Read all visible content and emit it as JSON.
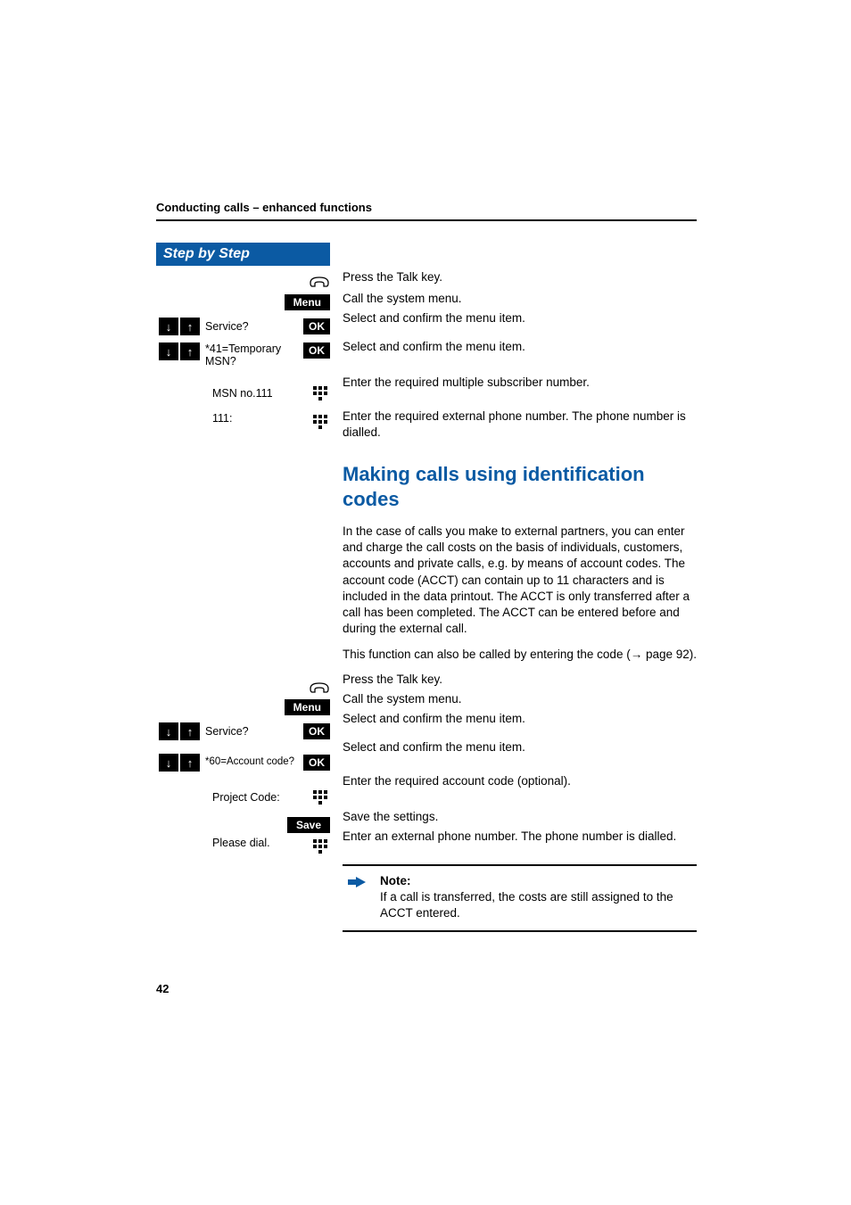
{
  "header": "Conducting calls – enhanced functions",
  "sbs_title": "Step by Step",
  "btn": {
    "ok": "OK",
    "menu": "Menu",
    "save": "Save"
  },
  "section1": {
    "steps": [
      {
        "kind": "talk",
        "right": "Press the Talk key."
      },
      {
        "kind": "menu",
        "right": "Call the system menu."
      },
      {
        "kind": "navok",
        "label": "Service?",
        "right": "Select and confirm the menu item."
      },
      {
        "kind": "navok",
        "label": "*41=Temporary MSN?",
        "right": "Select and confirm the menu item."
      },
      {
        "kind": "keypad",
        "label": "MSN no.111",
        "right": "Enter the required multiple subscriber number."
      },
      {
        "kind": "keypad",
        "label": "111:",
        "right": "Enter the required external phone number. The phone number is dialled."
      }
    ]
  },
  "heading2": "Making calls using identification codes",
  "para1": "In the case of calls you make to external partners, you can enter and charge the call costs on the basis of individuals, customers, accounts and private calls, e.g.  by means of account codes. The account code (ACCT) can contain up to 11 characters and is included in the data printout. The ACCT is only transferred after a call has been completed. The ACCT can be entered before and during the external call.",
  "para2_pre": "This function can also be called by entering the code (",
  "para2_arrow": "→",
  "para2_post": " page 92).",
  "section2": {
    "steps": [
      {
        "kind": "talk",
        "right": "Press the Talk key."
      },
      {
        "kind": "menu",
        "right": "Call the system menu."
      },
      {
        "kind": "navok",
        "label": "Service?",
        "right": "Select and confirm the menu item."
      },
      {
        "kind": "navok",
        "label": "*60=Account code?",
        "right": "Select and confirm the menu item."
      },
      {
        "kind": "keypad",
        "label": "Project Code:",
        "right": "Enter the required account code (optional)."
      },
      {
        "kind": "save",
        "right": "Save the settings."
      },
      {
        "kind": "keypad",
        "label": "Please dial.",
        "right": "Enter an external phone number. The phone number is dialled."
      }
    ]
  },
  "note": {
    "title": "Note:",
    "body": "If a call is transferred, the costs are still assigned to the ACCT entered."
  },
  "page_number": "42"
}
